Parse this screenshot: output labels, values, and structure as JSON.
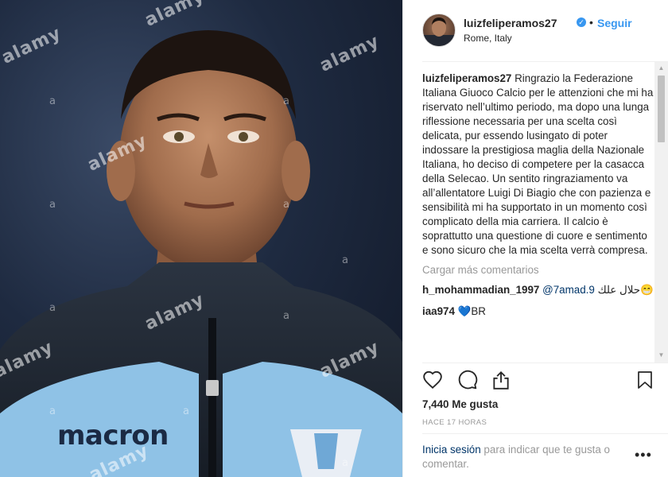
{
  "post": {
    "username": "luizfeliperamos27",
    "verified_mark": "✓",
    "dot": "•",
    "follow_label": "Seguir",
    "location": "Rome, Italy",
    "caption_user": "luizfeliperamos27",
    "caption_text": "Ringrazio la Federazione Italiana Giuoco Calcio per le attenzioni che mi ha riservato nell’ultimo periodo, ma dopo una lunga riflessione necessaria per una scelta così delicata, pur essendo lusingato di poter indossare la prestigiosa maglia della Nazionale Italiana, ho deciso di competere per la casacca della Selecao. Un sentito ringraziamento va all’allentatore Luigi Di Biagio che con pazienza e sensibilità mi ha supportato in un momento così complicato della mia carriera. Il calcio è soprattutto una questione di cuore e sentimento e sono sicuro che la mia scelta verrà compresa.",
    "load_more": "Cargar más comentarios",
    "comments": [
      {
        "user": "h_mohammadian_1997",
        "mention": "@7amad.9",
        "text": " حلال علك😁"
      },
      {
        "user": "iaa974",
        "text": " 💙BR"
      }
    ],
    "likes": "7,440 Me gusta",
    "time": "HACE 17 HORAS",
    "login_link": "Inicia sesión",
    "login_text": " para indicar que te gusta o comentar.",
    "more_label": "•••"
  },
  "photo": {
    "watermark_big": "alamy",
    "watermark_small": "a",
    "shirt_brand": "macron"
  },
  "icons": [
    "heart-icon",
    "comment-icon",
    "share-icon",
    "bookmark-icon",
    "verified-icon",
    "more-icon"
  ],
  "colors": {
    "link": "#3897f0",
    "mention": "#003569",
    "muted": "#999999"
  }
}
